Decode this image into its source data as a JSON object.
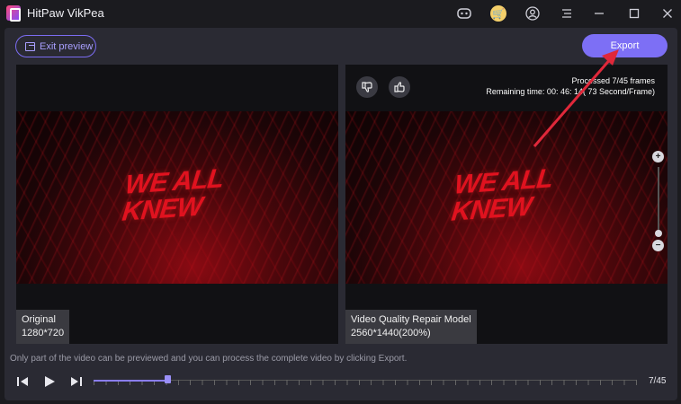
{
  "app": {
    "title": "HitPaw VikPea"
  },
  "titlebar": {
    "icons": [
      "discord-icon",
      "cart-icon",
      "user-icon",
      "menu-icon",
      "minimize-icon",
      "maximize-icon",
      "close-icon"
    ]
  },
  "toolbar": {
    "exit_label": "Exit preview",
    "export_label": "Export"
  },
  "original": {
    "label": "Original",
    "resolution": "1280*720"
  },
  "repaired": {
    "model_label": "Video Quality Repair Model",
    "resolution": "2560*1440(200%)",
    "processed": "Processed 7/45 frames",
    "remaining": "Remaining time: 00: 46: 14( 73 Second/Frame)"
  },
  "video": {
    "title_line1": "WE ALL",
    "title_line2": "KNEW"
  },
  "footer": {
    "info": "Only part of the video can be previewed and you can process the complete video by clicking Export.",
    "frame_counter": "7/45",
    "current_frame": 7,
    "total_frames": 45
  },
  "colors": {
    "accent": "#7d6ff5",
    "arrow": "#e0283a",
    "panel": "#2a2a33"
  }
}
